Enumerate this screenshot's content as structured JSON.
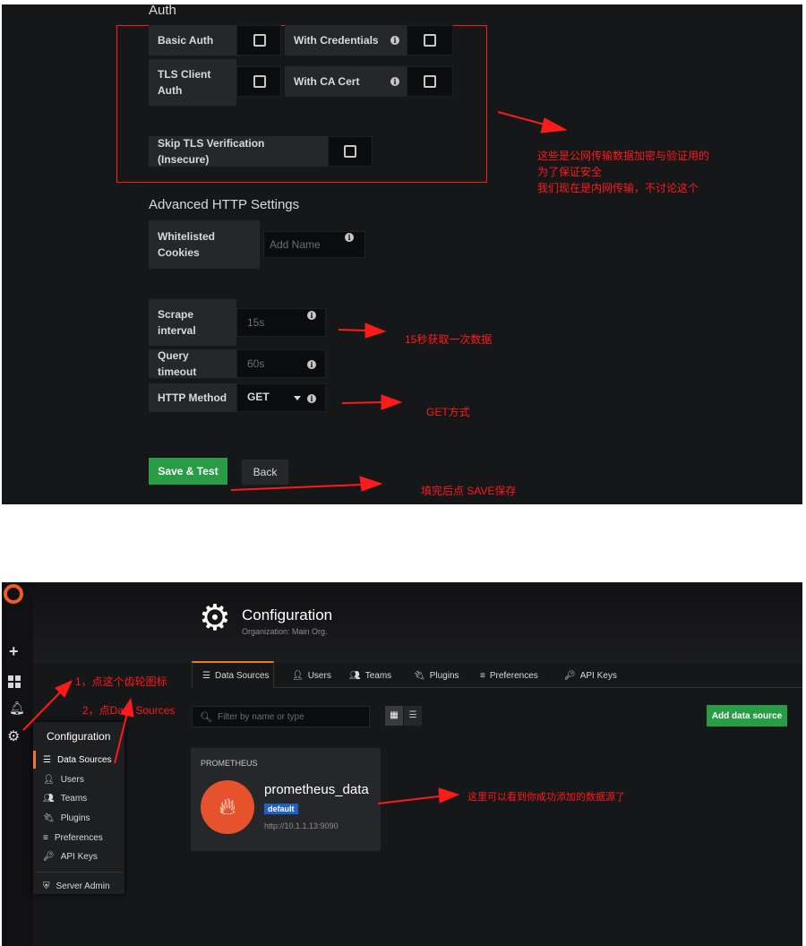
{
  "auth_form": {
    "section_title": "Auth",
    "basic_auth_label": "Basic Auth",
    "with_credentials_label": "With Credentials",
    "tls_client_auth_label": "TLS Client Auth",
    "with_ca_cert_label": "With CA Cert",
    "skip_tls_label": "Skip TLS Verification (Insecure)"
  },
  "advanced": {
    "section_title": "Advanced HTTP Settings",
    "whitelisted_cookies_label": "Whitelisted Cookies",
    "whitelisted_cookies_placeholder": "Add Name",
    "scrape_interval_label": "Scrape interval",
    "scrape_interval_placeholder": "15s",
    "query_timeout_label": "Query timeout",
    "query_timeout_placeholder": "60s",
    "http_method_label": "HTTP Method",
    "http_method_value": "GET"
  },
  "buttons": {
    "save_test": "Save & Test",
    "back": "Back"
  },
  "annotations": {
    "auth_note_line1": "这些是公网传输数据加密与验证用的",
    "auth_note_line2": "为了保证安全",
    "auth_note_line3": "我们现在是内网传输，不讨论这个",
    "scrape_note": "15秒获取一次数据",
    "method_note": "GET方式",
    "save_note": "填完后点 SAVE保存",
    "gear_note": "1，点这个齿轮图标",
    "datasources_note": "2，点Data Sources",
    "added_note": "这里可以看到你成功添加的数据源了"
  },
  "config": {
    "title": "Configuration",
    "subtitle": "Organization: Main Org.",
    "tabs": [
      "Data Sources",
      "Users",
      "Teams",
      "Plugins",
      "Preferences",
      "API Keys"
    ],
    "search_placeholder": "Filter by name or type",
    "add_button": "Add data source"
  },
  "side_menu": {
    "header": "Configuration",
    "items": [
      "Data Sources",
      "Users",
      "Teams",
      "Plugins",
      "Preferences",
      "API Keys"
    ],
    "server_admin": "Server Admin"
  },
  "datasource_card": {
    "type": "PROMETHEUS",
    "name": "prometheus_data",
    "badge": "default",
    "url": "http://10.1.1.13:9090"
  },
  "colors": {
    "accent_red": "#ff1a1a",
    "save_green": "#299c46",
    "badge_blue": "#1f60c4",
    "tab_orange": "#eb7b18",
    "prometheus_orange": "#e6522c"
  }
}
